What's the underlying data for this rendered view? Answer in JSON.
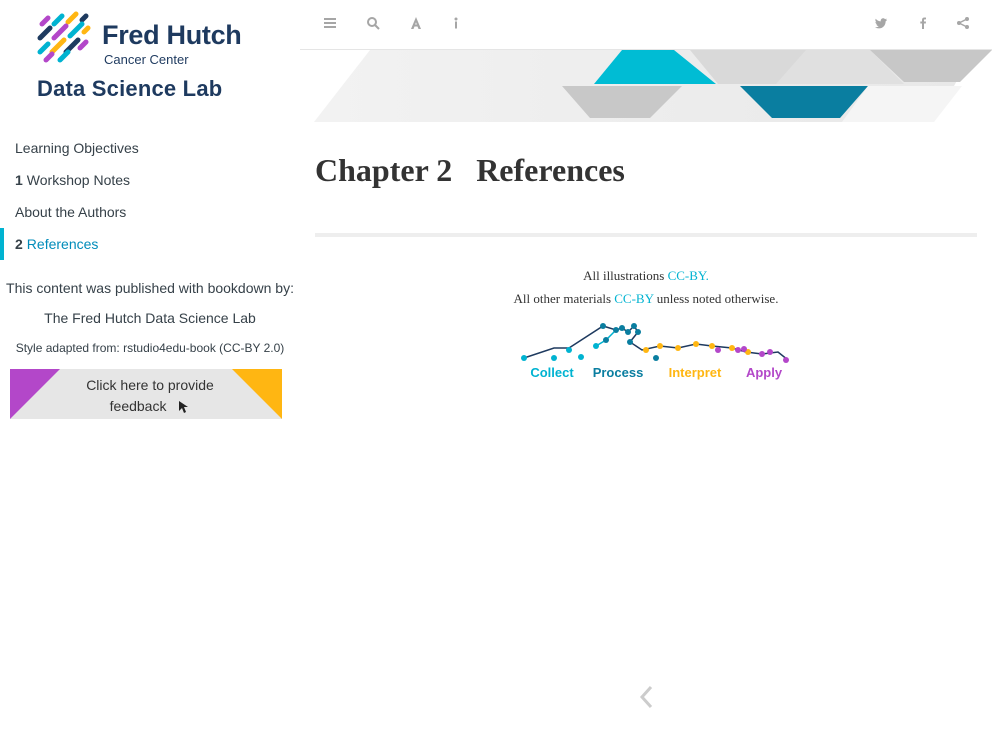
{
  "sidebar": {
    "logo": {
      "org": "Fred Hutch",
      "sub": "Cancer Center",
      "lab": "Data Science Lab"
    },
    "toc": [
      {
        "num": "",
        "label": "Learning Objectives",
        "active": false
      },
      {
        "num": "1",
        "label": "Workshop Notes",
        "active": false
      },
      {
        "num": "",
        "label": "About the Authors",
        "active": false
      },
      {
        "num": "2",
        "label": "References",
        "active": true
      }
    ],
    "published": "This content was published with bookdown by:",
    "lab_name": "The Fred Hutch Data Science Lab",
    "style_note": "Style adapted from: rstudio4edu-book (CC-BY 2.0)",
    "feedback": {
      "line1": "Click here to provide",
      "line2": "feedback"
    }
  },
  "toolbar": {
    "icons": [
      "menu-icon",
      "search-icon",
      "font-icon",
      "info-icon",
      "twitter-icon",
      "facebook-icon",
      "share-icon"
    ]
  },
  "main": {
    "chapter_label": "Chapter 2",
    "chapter_title": "References",
    "license1_pre": "All illustrations ",
    "license1_link": "CC-BY.",
    "license2_pre": "All other materials ",
    "license2_link": "CC-BY",
    "license2_post": " unless noted otherwise.",
    "graphic_labels": [
      "Collect",
      "Process",
      "Interpret",
      "Apply"
    ]
  },
  "colors": {
    "accent": "#00b3d1",
    "navy": "#1e3a5f",
    "purple": "#b347c9",
    "gold": "#ffb612",
    "teal_dark": "#0a7ea0"
  }
}
